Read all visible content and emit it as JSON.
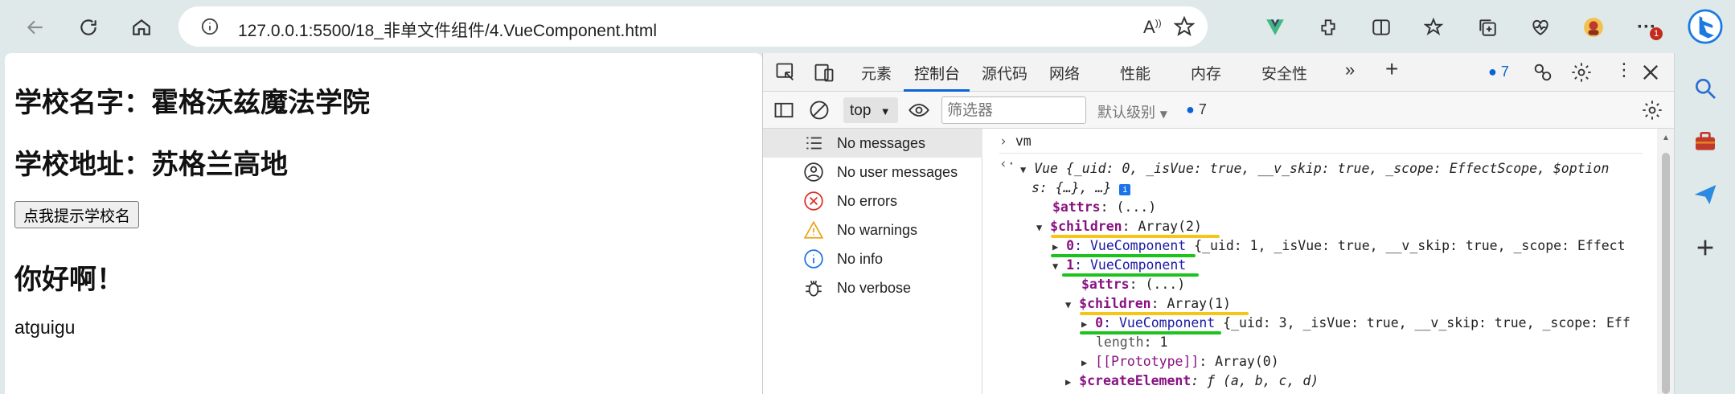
{
  "browser": {
    "url": "127.0.0.1:5500/18_非单文件组件/4.VueComponent.html",
    "icons": [
      "back-icon",
      "reload-icon",
      "home-icon",
      "info-icon",
      "read-aloud-icon",
      "favorite-icon",
      "vue-devtools-icon",
      "extensions-icon",
      "split-screen-icon",
      "favorites-icon",
      "collections-icon",
      "performance-icon",
      "profile-avatar",
      "more-icon",
      "bing-icon"
    ],
    "notification_count": "1"
  },
  "page": {
    "school_name": "学校名字：霍格沃兹魔法学院",
    "school_address": "学校地址：苏格兰高地",
    "button_label": "点我提示学校名",
    "greeting": "你好啊！",
    "name": "atguigu"
  },
  "devtools": {
    "tabs": [
      {
        "label": "元素"
      },
      {
        "label": "控制台"
      },
      {
        "label": "源代码"
      },
      {
        "label": "网络"
      },
      {
        "label": "性能"
      },
      {
        "label": "内存"
      },
      {
        "label": "安全性"
      }
    ],
    "active_tab": "控制台",
    "issue_count": "7",
    "context": "top",
    "filter_placeholder": "筛选器",
    "levels": "默认级别",
    "message_count": "7",
    "sidebar": [
      {
        "label": "No messages",
        "icon": "list-icon"
      },
      {
        "label": "No user messages",
        "icon": "user-icon"
      },
      {
        "label": "No errors",
        "icon": "error-icon"
      },
      {
        "label": "No warnings",
        "icon": "warning-icon"
      },
      {
        "label": "No info",
        "icon": "info-icon"
      },
      {
        "label": "No verbose",
        "icon": "bug-icon"
      }
    ],
    "console": {
      "input": "vm",
      "l1a": "Vue {_uid: 0, _isVue: true, __v_skip: true, _scope: EffectScope, $option",
      "l1b": "s: {…}, …}",
      "attrs": "$attrs",
      "attrs_val": ": (...)",
      "children": "$children",
      "children_val": ": Array(2)",
      "c0_key": "0",
      "c0_type": ": VueComponent",
      "c0_val": " {_uid: 1, _isVue: true, __v_skip: true, _scope: Effect",
      "c1_key": "1",
      "c1_type": ": VueComponent",
      "c1_attrs": "$attrs",
      "c1_attrs_val": ": (...)",
      "c1_children": "$children",
      "c1_children_val": ": Array(1)",
      "g0_key": "0",
      "g0_type": ": VueComponent",
      "g0_val": " {_uid: 3, _isVue: true, __v_skip: true, _scope: Eff",
      "length_key": "length",
      "length_val": ": 1",
      "proto_key": "[[Prototype]]",
      "proto_val": ": Array(0)",
      "create_key": "$createElement",
      "create_val": ": ƒ (a, b, c, d)"
    }
  },
  "colors": {
    "chrome_bg": "#dfe9ea",
    "accent": "#0a64d8",
    "key": "#881280",
    "underline_orange": "#f5c518",
    "underline_green": "#1ec21e"
  }
}
